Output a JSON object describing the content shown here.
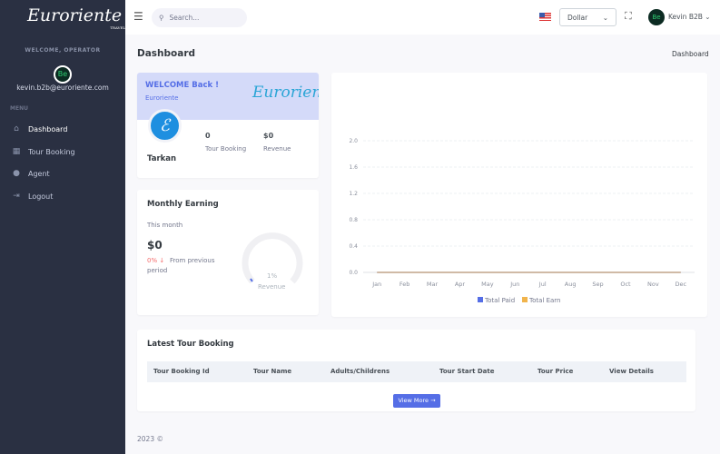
{
  "sidebar": {
    "logo": "Euroriente",
    "logo_sub": "TRAVEL",
    "welcome": "WELCOME, OPERATOR",
    "avatar_text": "Be",
    "email": "kevin.b2b@euroriente.com",
    "menu_label": "MENU",
    "items": [
      {
        "label": "Dashboard",
        "icon": "home-icon"
      },
      {
        "label": "Tour Booking",
        "icon": "building-icon"
      },
      {
        "label": "Agent",
        "icon": "user-icon"
      },
      {
        "label": "Logout",
        "icon": "logout-icon"
      }
    ]
  },
  "header": {
    "search_placeholder": "Search...",
    "currency": "Dollar",
    "user": "Kevin B2B"
  },
  "page": {
    "title": "Dashboard",
    "breadcrumb": "Dashboard"
  },
  "welcome_card": {
    "title": "WELCOME Back !",
    "subtitle": "Euroriente",
    "logo": "Euroriente",
    "name": "Tarkan",
    "bookings": "0",
    "bookings_label": "Tour Booking",
    "revenue": "$0",
    "revenue_label": "Revenue"
  },
  "monthly": {
    "title": "Monthly Earning",
    "period": "This month",
    "amount": "$0",
    "change": "0% ↓",
    "change_text": "From previous",
    "change_text2": "period",
    "gauge_value": "1%",
    "gauge_label": "Revenue",
    "gauge_fraction": 0.01
  },
  "chart_data": {
    "type": "line",
    "categories": [
      "Jan",
      "Feb",
      "Mar",
      "Apr",
      "May",
      "Jun",
      "Jul",
      "Aug",
      "Sep",
      "Oct",
      "Nov",
      "Dec"
    ],
    "yticks": [
      "0.0",
      "0.4",
      "0.8",
      "1.2",
      "1.6",
      "2.0"
    ],
    "ylim": [
      0,
      2
    ],
    "series": [
      {
        "name": "Total Paid",
        "color": "#556ee6",
        "values": [
          0,
          0,
          0,
          0,
          0,
          0,
          0,
          0,
          0,
          0,
          0,
          0
        ]
      },
      {
        "name": "Total Earn",
        "color": "#f1b44c",
        "values": [
          0,
          0,
          0,
          0,
          0,
          0,
          0,
          0,
          0,
          0,
          0,
          0
        ]
      }
    ],
    "legend": "bottom"
  },
  "bookings": {
    "title": "Latest Tour Booking",
    "columns": [
      "Tour Booking Id",
      "Tour Name",
      "Adults/Childrens",
      "Tour Start Date",
      "Tour Price",
      "View Details"
    ],
    "view_more": "View More →"
  },
  "footer": "2023 ©"
}
